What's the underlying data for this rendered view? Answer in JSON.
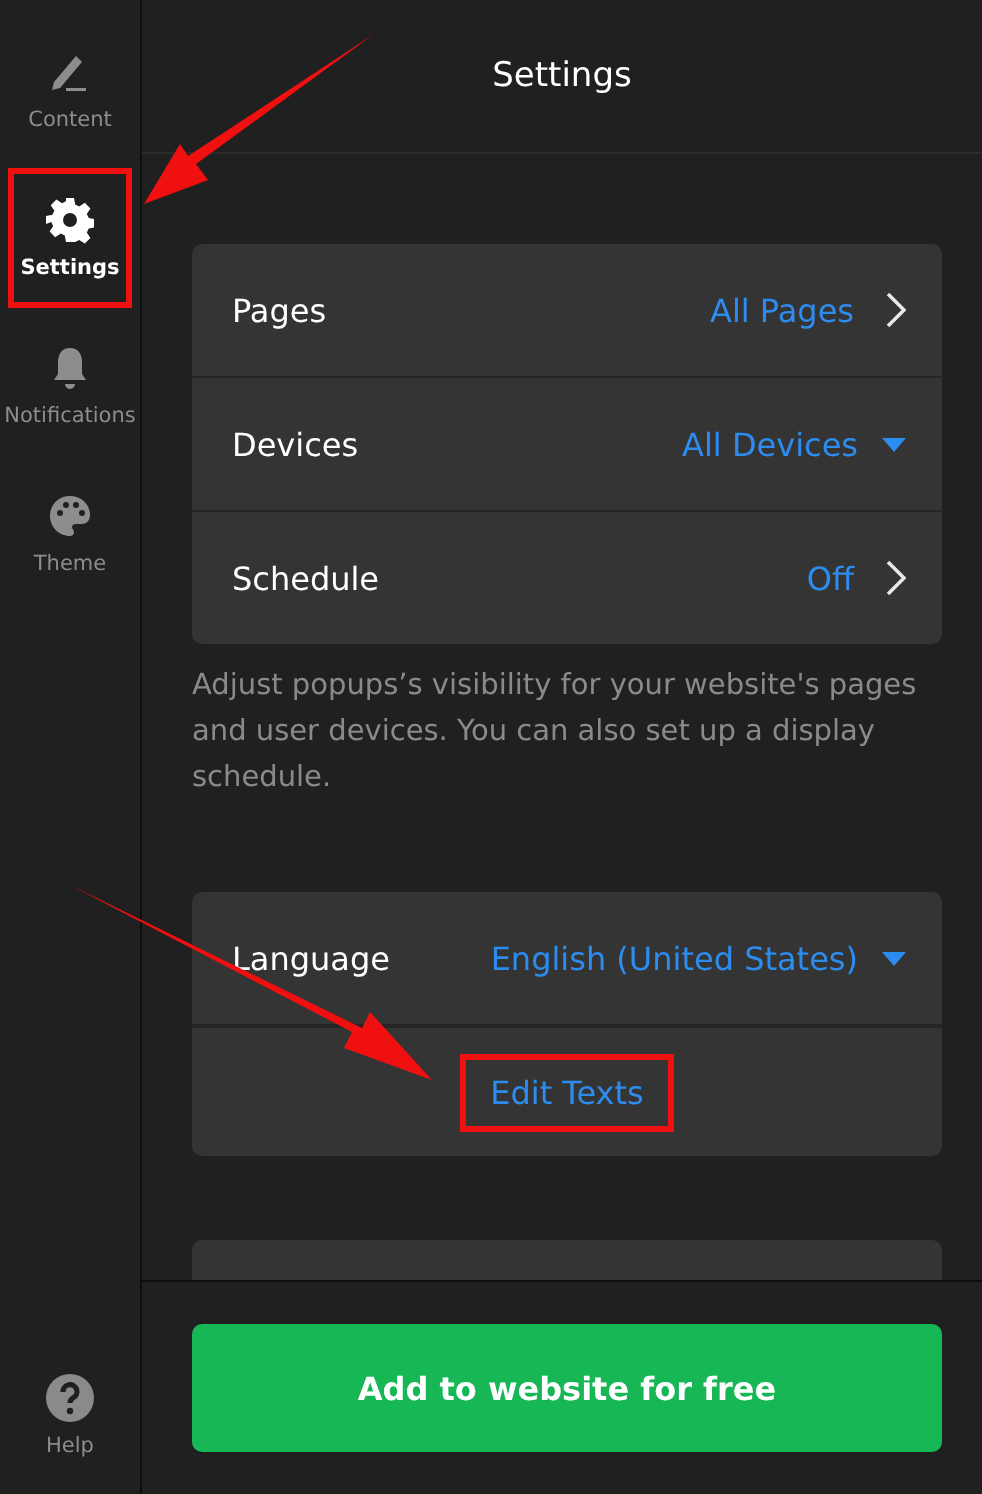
{
  "sidebar": {
    "items": [
      {
        "kind": "pencil",
        "label": "Content",
        "selected": false,
        "highlighted": false
      },
      {
        "kind": "gear",
        "label": "Settings",
        "selected": true,
        "highlighted": true
      },
      {
        "kind": "bell",
        "label": "Notifications",
        "selected": false,
        "highlighted": false
      },
      {
        "kind": "palette",
        "label": "Theme",
        "selected": false,
        "highlighted": false
      }
    ],
    "help": {
      "label": "Help"
    }
  },
  "header": {
    "title": "Settings"
  },
  "visibility": {
    "rows": [
      {
        "label": "Pages",
        "value": "All Pages",
        "kind": "link"
      },
      {
        "label": "Devices",
        "value": "All Devices",
        "kind": "dropdown"
      },
      {
        "label": "Schedule",
        "value": "Off",
        "kind": "link"
      }
    ],
    "description": "Adjust popups’s visibility for your website's pages and user devices. You can also set up a display schedule."
  },
  "language": {
    "label": "Language",
    "value": "English (United States)",
    "edit_button": {
      "label": "Edit Texts",
      "highlighted": true
    }
  },
  "footer": {
    "button": "Add to website for free"
  }
}
